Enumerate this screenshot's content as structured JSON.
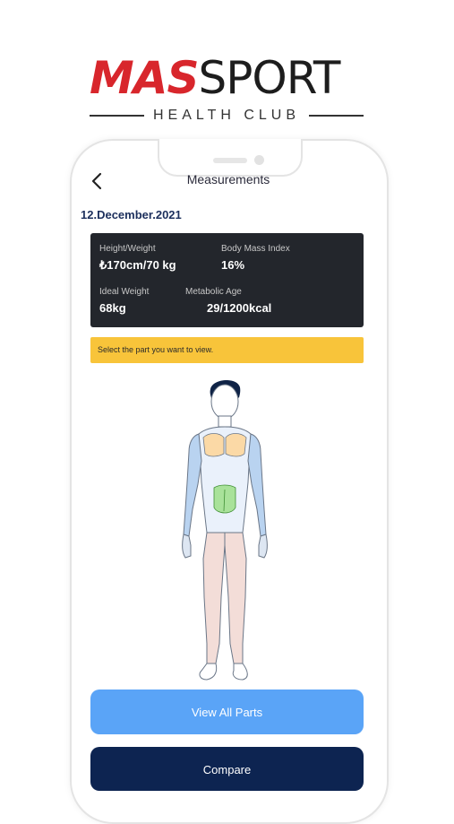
{
  "logo": {
    "mas": "MAS",
    "sport": "SPORT",
    "subtitle": "HEALTH CLUB"
  },
  "header": {
    "title": "Measurements",
    "back_icon": "chevron-left-icon"
  },
  "date": "12.December.2021",
  "stats": {
    "height_weight_label": "Height/Weight",
    "height_weight_value": "₺170cm/70 kg",
    "bmi_label": "Body Mass Index",
    "bmi_value": "16%",
    "ideal_weight_label": "Ideal Weight",
    "ideal_weight_value": "68kg",
    "metabolic_age_label": "Metabolic Age",
    "metabolic_age_value": "29/1200kcal"
  },
  "hint": "Select the part you want to view.",
  "buttons": {
    "view_all": "View All Parts",
    "compare": "Compare"
  },
  "colors": {
    "brand_red": "#d8262c",
    "stats_bg": "#23262c",
    "hint_bg": "#f8c43a",
    "view_btn": "#5aa4f7",
    "compare_btn": "#0d2451",
    "chest_highlight": "#fbd9a6",
    "abs_highlight": "#a9e29a",
    "arm_highlight": "#b9d3f0",
    "leg_highlight": "#f3ddd8"
  }
}
